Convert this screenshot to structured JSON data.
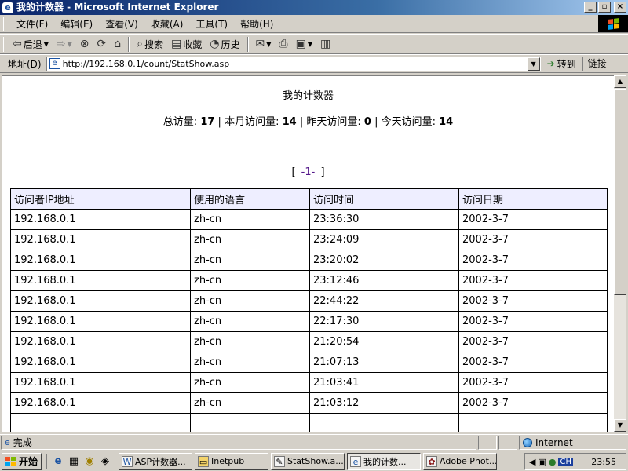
{
  "window": {
    "title": "我的计数器 - Microsoft Internet Explorer"
  },
  "menu": [
    "文件(F)",
    "编辑(E)",
    "查看(V)",
    "收藏(A)",
    "工具(T)",
    "帮助(H)"
  ],
  "toolbar": {
    "back": "后退",
    "search": "搜索",
    "favorites": "收藏",
    "history": "历史"
  },
  "address": {
    "label": "地址(D)",
    "url": "http://192.168.0.1/count/StatShow.asp",
    "go": "转到",
    "links": "链接"
  },
  "page": {
    "title": "我的计数器",
    "stats": {
      "total_label": "总访量:",
      "total": "17",
      "month_label": "本月访问量:",
      "month": "14",
      "yesterday_label": "昨天访问量:",
      "yesterday": "0",
      "today_label": "今天访问量:",
      "today": "14"
    },
    "pager": {
      "open": "[",
      "link": "-1-",
      "close": "]"
    },
    "table": {
      "headers": [
        "访问者IP地址",
        "使用的语言",
        "访问时间",
        "访问日期"
      ],
      "rows": [
        [
          "192.168.0.1",
          "zh-cn",
          "23:36:30",
          "2002-3-7"
        ],
        [
          "192.168.0.1",
          "zh-cn",
          "23:24:09",
          "2002-3-7"
        ],
        [
          "192.168.0.1",
          "zh-cn",
          "23:20:02",
          "2002-3-7"
        ],
        [
          "192.168.0.1",
          "zh-cn",
          "23:12:46",
          "2002-3-7"
        ],
        [
          "192.168.0.1",
          "zh-cn",
          "22:44:22",
          "2002-3-7"
        ],
        [
          "192.168.0.1",
          "zh-cn",
          "22:17:30",
          "2002-3-7"
        ],
        [
          "192.168.0.1",
          "zh-cn",
          "21:20:54",
          "2002-3-7"
        ],
        [
          "192.168.0.1",
          "zh-cn",
          "21:07:13",
          "2002-3-7"
        ],
        [
          "192.168.0.1",
          "zh-cn",
          "21:03:41",
          "2002-3-7"
        ],
        [
          "192.168.0.1",
          "zh-cn",
          "21:03:12",
          "2002-3-7"
        ],
        [
          "",
          "",
          "",
          ""
        ]
      ]
    }
  },
  "status": {
    "text": "完成",
    "zone": "Internet"
  },
  "taskbar": {
    "start": "开始",
    "tasks": [
      "ASP计数器...",
      "Inetpub",
      "StatShow.a...",
      "我的计数...",
      "Adobe Phot..."
    ],
    "lang": "CH",
    "clock": "23:55"
  },
  "colors": {
    "titlebar": "#0a246a",
    "chrome": "#d4d0c8",
    "header_row": "#eeeeff",
    "visited_link": "#551a8b"
  },
  "icons": [
    "ie-page-icon",
    "back-arrow-icon",
    "forward-arrow-icon",
    "stop-icon",
    "refresh-icon",
    "home-icon",
    "search-icon",
    "favorites-icon",
    "history-icon",
    "mail-icon",
    "print-icon",
    "edit-icon",
    "discuss-icon",
    "go-arrow-icon",
    "globe-icon",
    "windows-logo-icon"
  ]
}
